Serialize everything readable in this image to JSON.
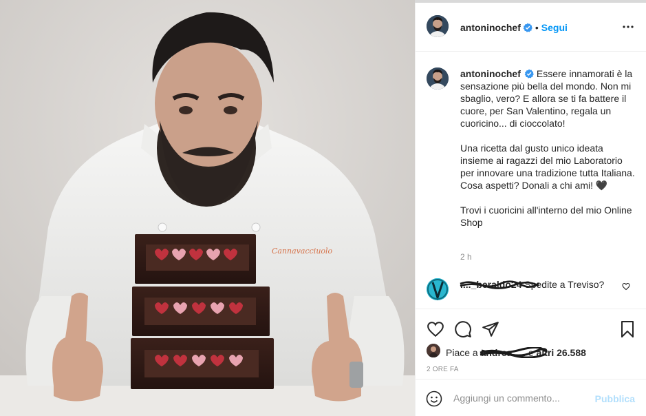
{
  "post": {
    "username": "antoninochef",
    "follow_label": "Segui",
    "separator": "•",
    "more_icon": "more-options-icon"
  },
  "caption": {
    "username": "antoninochef",
    "text": "Essere innamorati è la sensazione più bella del mondo. Non mi sbaglio, vero? E allora se ti fa battere il cuore, per San Valentino, regala un cuoricino... di cioccolato!\n\nUna ricetta dal gusto unico ideata insieme ai ragazzi del mio Laboratorio per innovare una tradizione tutta Italiana. Cosa aspetti? Donali a chi ami! 🖤\n\nTrovi i cuoricini all'interno del mio Online Shop",
    "time": "2 h"
  },
  "comment": {
    "username": "...._beraldo24",
    "text": "Spedite a Treviso?"
  },
  "likes": {
    "prefix": "Piace a",
    "hidden_user": "andrea.....",
    "middle": "e",
    "count_text": "altri 26.588"
  },
  "date": "2 ORE FA",
  "add_comment": {
    "placeholder": "Aggiungi un commento...",
    "publish_label": "Pubblica"
  },
  "colors": {
    "accent": "#0095f6",
    "publish_disabled": "#b2dffc",
    "muted": "#8e8e8e",
    "border": "#efefef"
  },
  "photo": {
    "brand_on_jacket": "Cannavacciuolo"
  }
}
